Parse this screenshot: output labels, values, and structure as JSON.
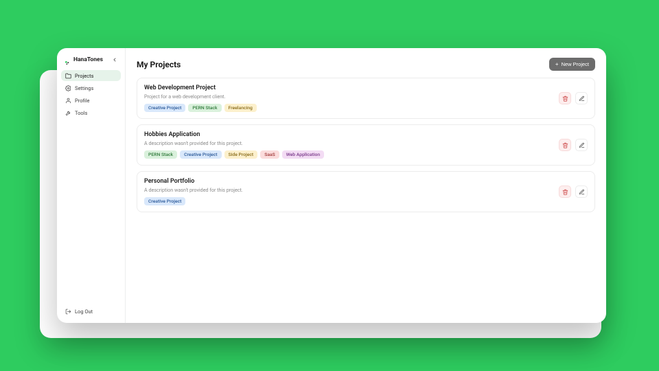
{
  "brand": {
    "name": "HanaTones"
  },
  "sidebar": {
    "items": [
      {
        "label": "Projects",
        "icon": "folder-icon",
        "active": true
      },
      {
        "label": "Settings",
        "icon": "gear-icon",
        "active": false
      },
      {
        "label": "Profile",
        "icon": "user-icon",
        "active": false
      },
      {
        "label": "Tools",
        "icon": "wrench-icon",
        "active": false
      }
    ],
    "logout_label": "Log Out"
  },
  "page": {
    "title": "My Projects",
    "new_button_label": "New Project"
  },
  "tag_palette": {
    "Creative Project": {
      "bg": "#d9e8fb",
      "fg": "#2c5a9a"
    },
    "PERN Stack": {
      "bg": "#daf1dc",
      "fg": "#2f7a3a"
    },
    "Freelancing": {
      "bg": "#fcf0cc",
      "fg": "#8a6d1b"
    },
    "Side Project": {
      "bg": "#fcf0cc",
      "fg": "#8a6d1b"
    },
    "SaaS": {
      "bg": "#fbdcdc",
      "fg": "#a03a3a"
    },
    "Web Application": {
      "bg": "#f3dcf4",
      "fg": "#7a3a8a"
    }
  },
  "projects": [
    {
      "title": "Web Development Project",
      "description": "Project for a web development client.",
      "tags": [
        "Creative Project",
        "PERN Stack",
        "Freelancing"
      ]
    },
    {
      "title": "Hobbies Application",
      "description": "A description wasn't provided for this project.",
      "tags": [
        "PERN Stack",
        "Creative Project",
        "Side Project",
        "SaaS",
        "Web Application"
      ]
    },
    {
      "title": "Personal Portfolio",
      "description": "A description wasn't provided for this project.",
      "tags": [
        "Creative Project"
      ]
    }
  ]
}
